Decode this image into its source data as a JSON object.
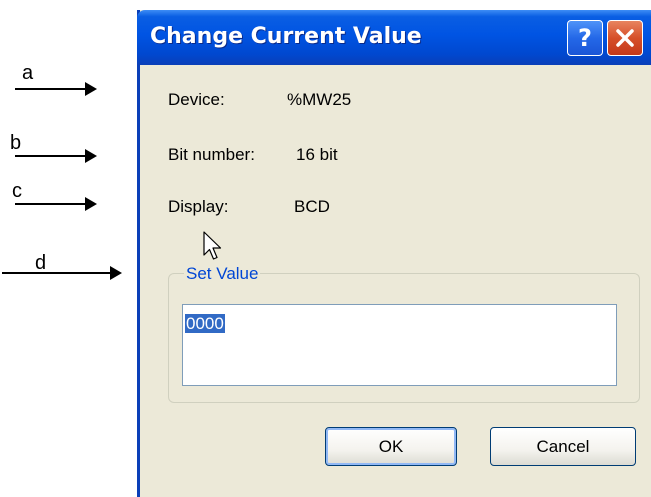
{
  "callouts": {
    "a": "a",
    "b": "b",
    "c": "c",
    "d": "d"
  },
  "dialog": {
    "title": "Change Current Value",
    "help_icon_glyph": "?",
    "rows": [
      {
        "label": "Device:",
        "value": "%MW25"
      },
      {
        "label": "Bit number:",
        "value": "16 bit"
      },
      {
        "label": "Display:",
        "value": "BCD"
      }
    ],
    "group_label": "Set Value",
    "input_value": "0000",
    "ok_label": "OK",
    "cancel_label": "Cancel"
  },
  "icons": {
    "help": "help-icon",
    "close": "close-icon",
    "cursor": "mouse-cursor-icon",
    "arrow": "arrow-right-icon"
  },
  "colors": {
    "titlebar": "#0054e3",
    "dialog_bg": "#ece9d8",
    "group_label": "#0046d5",
    "selection": "#316ac5",
    "close_button": "#d6502a"
  }
}
